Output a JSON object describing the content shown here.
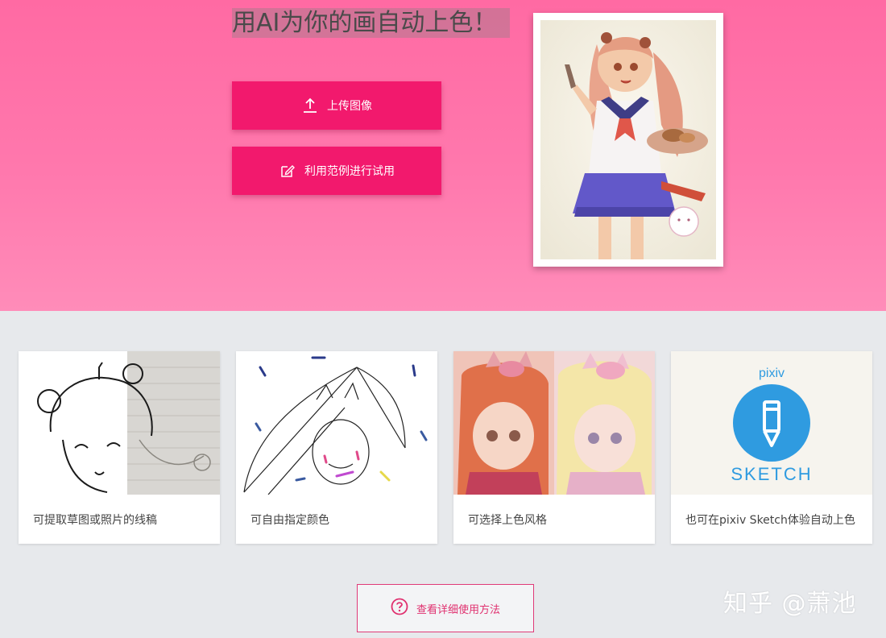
{
  "hero": {
    "title": "用AI为你的画自动上色！",
    "upload_label": "上传图像",
    "sample_label": "利用范例进行试用"
  },
  "cards": [
    {
      "caption": "可提取草图或照片的线稿"
    },
    {
      "caption": "可自由指定颜色"
    },
    {
      "caption": "可选择上色风格"
    },
    {
      "caption": "也可在pixiv Sketch体验自动上色",
      "logo_text": "pixiv",
      "logo_sub": "SKETCH"
    }
  ],
  "howto": {
    "label": "查看详细使用方法"
  },
  "watermark": "知乎 @萧池",
  "colors": {
    "accent": "#f2196d",
    "hero_bg": "#ff78ad",
    "sketch_blue": "#2f9be0"
  }
}
